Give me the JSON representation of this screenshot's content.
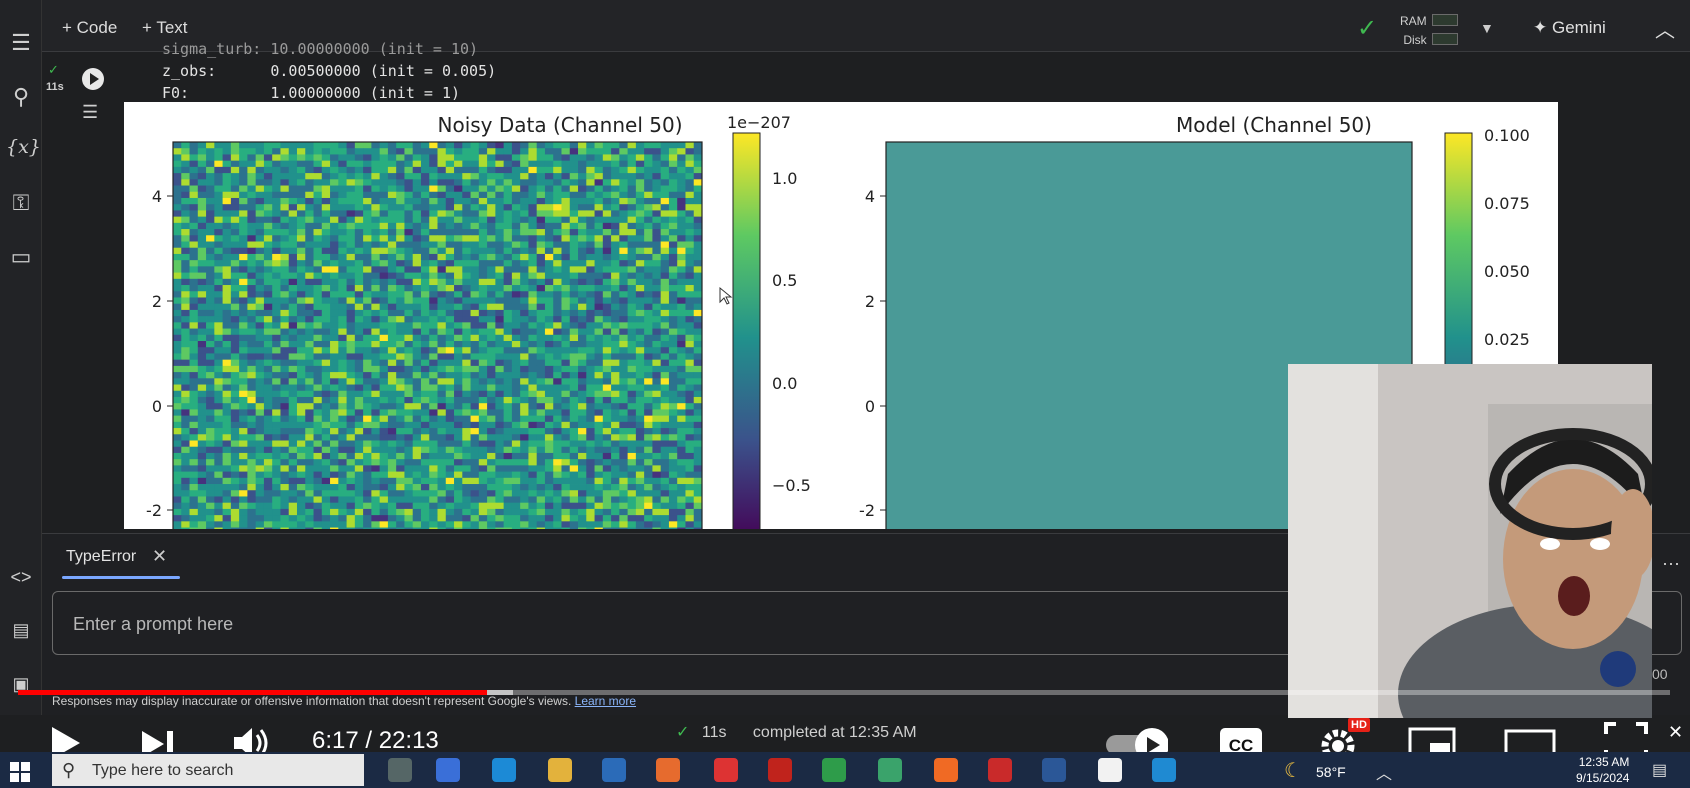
{
  "toolbar": {
    "code_label": "+ Code",
    "text_label": "+ Text",
    "ram_label": "RAM",
    "disk_label": "Disk",
    "gemini_label": "✦ Gemini"
  },
  "cell": {
    "time": "11s",
    "out_line0": "sigma_turb: 10.00000000 (init = 10)",
    "out_line1": "z_obs:      0.00500000 (init = 0.005)",
    "out_line2": "F0:         1.00000000 (init = 1)"
  },
  "chart_data": [
    {
      "type": "heatmap",
      "title": "Noisy Data (Channel 50)",
      "yticks": [
        "4",
        "2",
        "0",
        "-2"
      ],
      "colorbar": {
        "offset_label": "1e−207",
        "ticks": [
          "1.0",
          "0.5",
          "0.0",
          "−0.5"
        ]
      }
    },
    {
      "type": "heatmap",
      "title": "Model (Channel 50)",
      "yticks": [
        "4",
        "2",
        "0",
        "-2"
      ],
      "colorbar": {
        "ticks": [
          "0.100",
          "0.075",
          "0.050",
          "0.025"
        ]
      },
      "fill_color": "#4a9a97"
    }
  ],
  "gemini_panel": {
    "tab_label": "TypeError",
    "prompt_placeholder": "Enter a prompt here",
    "disclaimer": "Responses may display inaccurate or offensive information that doesn't represent Google's views.",
    "learn_more": "Learn more",
    "partial_text": "00"
  },
  "player": {
    "time_display": "6:17 / 22:13",
    "progress_fraction": 0.284,
    "hd_badge": "HD"
  },
  "status_bar": {
    "check": "✓",
    "elapsed": "11s",
    "completed": "completed at 12:35 AM"
  },
  "taskbar": {
    "search_placeholder": "Type here to search",
    "weather": "58°F",
    "time": "12:35 AM",
    "date": "9/15/2024"
  },
  "colors": {
    "accent": "#7aa7ff",
    "progress": "#ff0000",
    "success": "#3fb950"
  }
}
